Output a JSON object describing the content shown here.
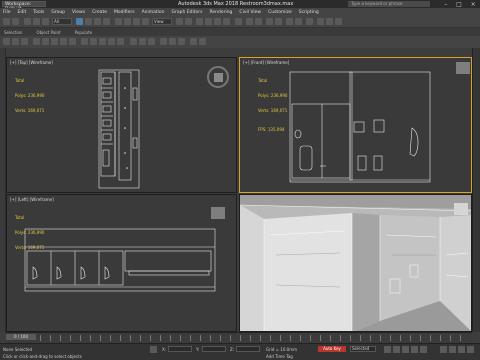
{
  "titlebar": {
    "workspace": "Workspace: Default",
    "title": "Autodesk 3ds Max 2018    Restroom3dmax.max",
    "search_placeholder": "Type a keyword or phrase"
  },
  "menu": [
    "File",
    "Edit",
    "Tools",
    "Group",
    "Views",
    "Create",
    "Modifiers",
    "Animation",
    "Graph Editors",
    "Rendering",
    "Civil View",
    "Customize",
    "Scripting"
  ],
  "toolbar": {
    "selection_filter": "All",
    "view_dropdown": "View"
  },
  "ribbon": [
    "Selection",
    "Object Paint",
    "Populate"
  ],
  "viewports": {
    "top": {
      "label": "[+] [Top] [Wireframe]",
      "stats": {
        "total": "Total",
        "polys": "Polys:   236,990",
        "verts": "Verts:   169,071"
      }
    },
    "front": {
      "label": "[+] [Front] [Wireframe]",
      "stats": {
        "total": "Total",
        "polys": "Polys:   236,990",
        "verts": "Verts:   169,071",
        "fps": "FPS:     135.094"
      }
    },
    "left": {
      "label": "[+] [Left] [Wireframe]",
      "stats": {
        "total": "Total",
        "polys": "Polys:   236,990",
        "verts": "Verts:   169,071"
      }
    },
    "perspective": {
      "label": ""
    }
  },
  "timeline": {
    "frame": "0 / 100"
  },
  "statusbar": {
    "message": "Click or click-and-drag to select objects",
    "none_selected": "None Selected",
    "x_label": "X:",
    "y_label": "Y:",
    "z_label": "Z:",
    "grid": "Grid = 10.0mm",
    "add_time_tag": "Add Time Tag",
    "auto_key": "Auto Key",
    "selected": "Selected"
  }
}
